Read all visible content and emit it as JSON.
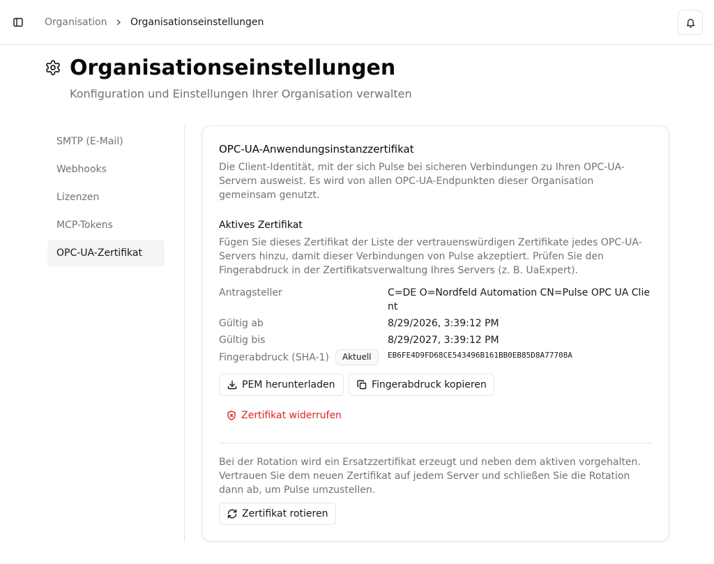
{
  "breadcrumb": {
    "parent": "Organisation",
    "current": "Organisationseinstellungen"
  },
  "icons": {
    "sidebar_toggle": "panel-left-icon",
    "chevron": "chevron-right-icon",
    "notifications": "bell-icon",
    "page": "gear-icon",
    "download": "download-icon",
    "copy": "copy-icon",
    "revoke": "shield-x-icon",
    "rotate": "refresh-icon"
  },
  "header": {
    "title": "Organisationseinstellungen",
    "subtitle": "Konfiguration und Einstellungen Ihrer Organisation verwalten"
  },
  "nav": {
    "items": [
      {
        "label": "SMTP (E-Mail)",
        "active": false
      },
      {
        "label": "Webhooks",
        "active": false
      },
      {
        "label": "Lizenzen",
        "active": false
      },
      {
        "label": "MCP-Tokens",
        "active": false
      },
      {
        "label": "OPC-UA-Zertifikat",
        "active": true
      }
    ]
  },
  "card": {
    "title": "OPC-UA-Anwendungsinstanzzertifikat",
    "description": "Die Client-Identität, mit der sich Pulse bei sicheren Verbindungen zu Ihren OPC-UA-Servern ausweist. Es wird von allen OPC-UA-Endpunkten dieser Organisation gemeinsam genutzt.",
    "active_title": "Aktives Zertifikat",
    "active_description": "Fügen Sie dieses Zertifikat der Liste der vertrauenswürdigen Zertifikate jedes OPC-UA-Servers hinzu, damit dieser Verbindungen von Pulse akzeptiert. Prüfen Sie den Fingerabdruck in der Zertifikatsverwaltung Ihres Servers (z. B. UaExpert).",
    "fields": {
      "subject_label": "Antragsteller",
      "subject_value": "C=DE O=Nordfeld Automation CN=Pulse OPC UA Client",
      "valid_from_label": "Gültig ab",
      "valid_from_value": "8/29/2026, 3:39:12 PM",
      "valid_to_label": "Gültig bis",
      "valid_to_value": "8/29/2027, 3:39:12 PM",
      "fingerprint_label": "Fingerabdruck (SHA-1)",
      "fingerprint_badge": "Aktuell",
      "fingerprint_value": "EB6FE4D9FD68CE543496B161BB0EB85D8A77708A"
    },
    "buttons": {
      "download_pem": "PEM herunterladen",
      "copy_fingerprint": "Fingerabdruck kopieren",
      "revoke": "Zertifikat widerrufen",
      "rotate": "Zertifikat rotieren"
    },
    "rotation_description": "Bei der Rotation wird ein Ersatzzertifikat erzeugt und neben dem aktiven vorgehalten. Vertrauen Sie dem neuen Zertifikat auf jedem Server und schließen Sie die Rotation dann ab, um Pulse umzustellen."
  },
  "colors": {
    "danger": "#dc2626",
    "muted": "#71717a",
    "border": "#e4e4e7"
  }
}
